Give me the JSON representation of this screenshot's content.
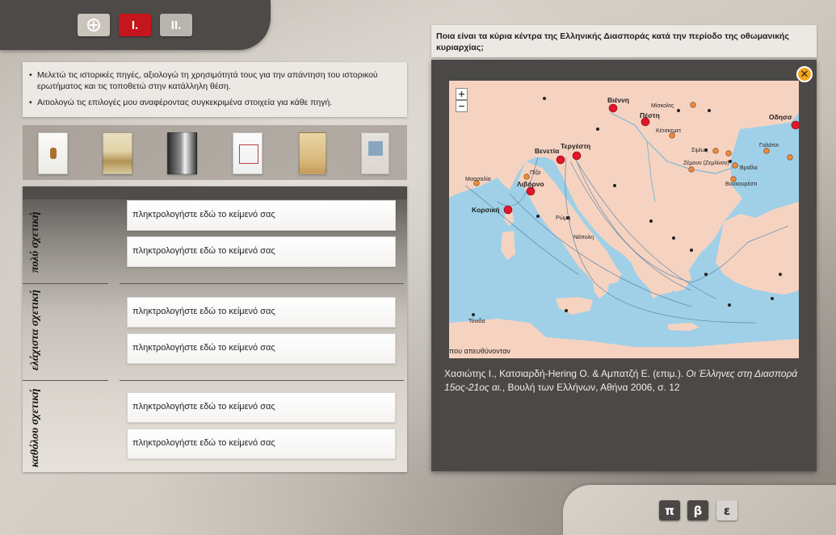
{
  "nav": {
    "compass_label": "",
    "tab1_label": "I.",
    "tab2_label": "II."
  },
  "instructions": [
    "Μελετώ τις ιστορικές πηγές, αξιολογώ τη χρησιμότητά τους για την απάντηση του ιστορικού ερωτήματος και τις τοποθετώ στην κατάλληλη θέση.",
    "Αιτιολογώ τις επιλογές μου αναφέροντας συγκεκριμένα στοιχεία για κάθε πηγή."
  ],
  "relevance": {
    "categories": [
      "πολύ σχετική",
      "ελάχιστα σχετική",
      "καθόλου σχετική"
    ],
    "placeholder": "πληκτρολογήστε εδώ το κείμενό σας"
  },
  "question": "Ποια είναι τα κύρια κέντρα της Ελληνικής Διασποράς κατά την περίοδο της οθωμανικής κυριαρχίας;",
  "popup": {
    "close_label": "✕",
    "zoom_in": "+",
    "zoom_out": "−",
    "caption_plain_1": "Χασιώτης Ι., Κατσιαρδή-Hering Ο. & Αμπατζή Ε. (επιμ.). ",
    "caption_italic": "Οι Έλληνες στη Διασπορά 15ος-21ος αι.",
    "caption_plain_2": ", Βουλή των Ελλήνων, Αθήνα 2006, σ. 12"
  },
  "map_labels": {
    "viena": "Βιέννη",
    "pesti": "Πέστη",
    "miskolts": "Μίσκολτς",
    "venetia": "Βενετία",
    "tergesti": "Τεργέστη",
    "odissos": "Οδησσ",
    "livorno": "Λιβόρνο",
    "massalia": "Μασσαλία",
    "korsiki": "Κορσική",
    "piza": "Πίζα",
    "napoli": "Νάπολη",
    "roma": "Ρώμη",
    "kechkemet": "Κέτσκεμετ",
    "galatsi": "Γαλάτσι",
    "braila": "Βραΐλα",
    "voukouresti": "Βουκουρέστι",
    "zemoun": "Ζέμουν (Ζεμλίνον)",
    "simios": "Σιμίως",
    "bottom_text": "που απευθύνονταν",
    "tynida": "Τύνιδα"
  },
  "footer": {
    "btn_p": "π",
    "btn_b": "β",
    "btn_e": "ε"
  }
}
